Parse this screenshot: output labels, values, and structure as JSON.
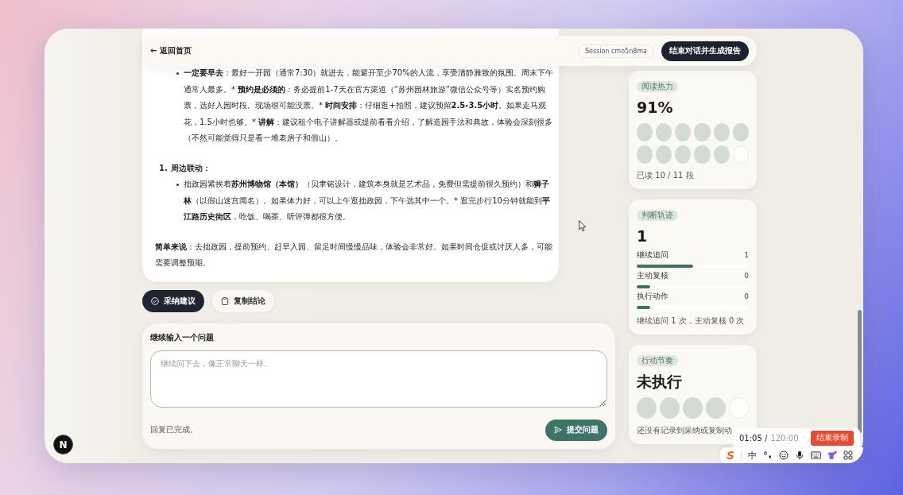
{
  "header": {
    "back_link": "← 返回首页",
    "session": "Session cmo5n8ma",
    "end_button": "结束对话并生成报告"
  },
  "answer": {
    "blocks": [
      {
        "kind": "bullet",
        "runs": [
          {
            "text": "一定要早去",
            "bold": true
          },
          {
            "text": "：最好一开园（通常7:30）就进去，能避开至少70%的人流，享受清静雅致的氛围。周末下午通常人最多。* ",
            "bold": false
          },
          {
            "text": "预约是必须的",
            "bold": true
          },
          {
            "text": "：务必提前1-7天在官方渠道（“苏州园林旅游”微信公众号等）实名预约购票，选好入园时段。现场很可能没票。* ",
            "bold": false
          },
          {
            "text": "时间安排",
            "bold": true
          },
          {
            "text": "：仔细逛+拍照，建议预留",
            "bold": false
          },
          {
            "text": "2.5-3.5小时",
            "bold": true
          },
          {
            "text": "。如果走马观花，1.5小时也够。* ",
            "bold": false
          },
          {
            "text": "讲解",
            "bold": true
          },
          {
            "text": "：建议租个电子讲解器或提前看看介绍，了解造园手法和典故，体验会深刻很多（不然可能觉得只是看一堆老房子和假山）。",
            "bold": false
          }
        ]
      },
      {
        "kind": "numbered",
        "number": "1.",
        "title": "周边联动：",
        "children": [
          {
            "kind": "bullet",
            "runs": [
              {
                "text": "拙政园紧挨着",
                "bold": false
              },
              {
                "text": "苏州博物馆（本馆）",
                "bold": true
              },
              {
                "text": "（贝聿铭设计，建筑本身就是艺术品，免费但需提前很久预约）和",
                "bold": false
              },
              {
                "text": "狮子林",
                "bold": true
              },
              {
                "text": "（以假山迷宫闻名）。如果体力好，可以上午逛拙政园，下午选其中一个。* 逛完步行10分钟就能到",
                "bold": false
              },
              {
                "text": "平江路历史街区",
                "bold": true
              },
              {
                "text": "，吃饭、喝茶、听评弹都很方便。",
                "bold": false
              }
            ]
          }
        ]
      },
      {
        "kind": "paragraph",
        "runs": [
          {
            "text": "简单来说",
            "bold": true
          },
          {
            "text": "：去拙政园，提前预约、赶早入园、留足时间慢慢品味，体验会非常好。如果时间仓促或讨厌人多，可能需要调整预期。",
            "bold": false
          }
        ]
      }
    ]
  },
  "actions": [
    {
      "kind": "adopt",
      "label": "采纳建议"
    },
    {
      "kind": "copy",
      "label": "复制结论"
    }
  ],
  "composer": {
    "label": "继续输入一个问题",
    "placeholder": "继续问下去，像正常聊天一样。",
    "status": "回复已完成。",
    "submit": "提交问题"
  },
  "sidebar": {
    "cards": [
      {
        "kind": "heat",
        "tag": "阅读热力",
        "value": "91%",
        "cells": [
          {
            "filled": true
          },
          {
            "filled": true
          },
          {
            "filled": true
          },
          {
            "filled": true
          },
          {
            "filled": true
          },
          {
            "filled": true
          },
          {
            "filled": true
          },
          {
            "filled": true
          },
          {
            "filled": true
          },
          {
            "filled": true
          },
          {
            "filled": true
          },
          {
            "filled": false
          }
        ],
        "caption": "已读 10 / 11 段"
      },
      {
        "kind": "metrics",
        "tag": "判断轨迹",
        "value": "1",
        "metrics": [
          {
            "label": "继续追问",
            "count": "1",
            "level": 0.5
          },
          {
            "label": "主动复核",
            "count": "0",
            "level": 0.12
          },
          {
            "label": "执行动作",
            "count": "0",
            "level": 0.12
          }
        ],
        "caption": "继续追问 1 次，主动复核 0 次"
      },
      {
        "kind": "rhythm",
        "tag": "行动节奏",
        "value": "未执行",
        "cells": [
          {
            "filled": true
          },
          {
            "filled": true
          },
          {
            "filled": true
          },
          {
            "filled": true
          },
          {
            "filled": false
          }
        ],
        "caption": "还没有记录到采纳或复制动"
      }
    ]
  },
  "dev_badge": "N",
  "recording": {
    "elapsed": "01:05 /",
    "limit": "120:00",
    "stop_button": "结束录制"
  },
  "ime_toolbar": {
    "logo": "S",
    "mode": "中"
  }
}
